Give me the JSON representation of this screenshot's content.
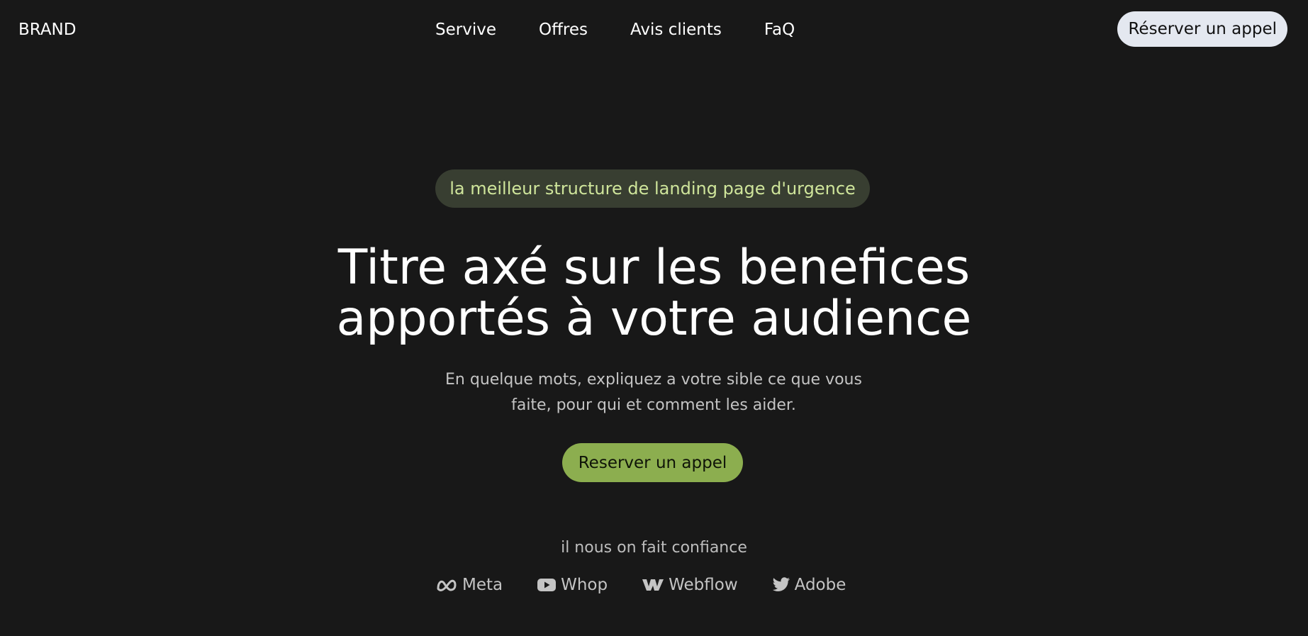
{
  "nav": {
    "brand": "BRAND",
    "links": [
      "Servive",
      "Offres",
      "Avis clients",
      "FaQ"
    ],
    "cta_label": "Réserver un appel"
  },
  "hero": {
    "badge": "la meilleur structure de landing page d'urgence",
    "title_line1": "Titre axé sur les benefices",
    "title_line2": "apportés à votre audience",
    "subtitle_line1": "En quelque mots, expliquez a votre sible ce que vous",
    "subtitle_line2": "faite, pour qui et comment les aider.",
    "cta_label": "Reserver un appel"
  },
  "trust": {
    "label": "il nous on fait confiance",
    "logos": [
      {
        "name": "Meta",
        "icon": "meta-icon"
      },
      {
        "name": "Whop",
        "icon": "youtube-play-icon"
      },
      {
        "name": "Webflow",
        "icon": "webflow-icon"
      },
      {
        "name": "Adobe",
        "icon": "twitter-bird-icon"
      }
    ]
  },
  "colors": {
    "background": "#181818",
    "badge_bg": "#383e31",
    "badge_text": "#cfe59b",
    "accent_green": "#8cae4f",
    "nav_cta_bg": "#e4e8f0"
  }
}
